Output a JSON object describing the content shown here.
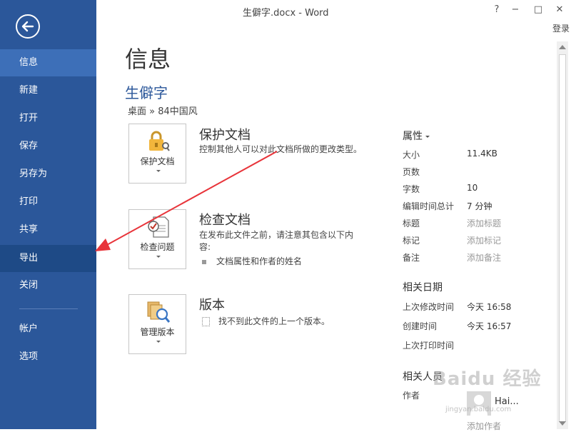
{
  "window": {
    "title": "生僻字.docx - Word",
    "help": "?",
    "minimize": "−",
    "maximize": "□",
    "close": "✕",
    "login": "登录"
  },
  "sidebar": {
    "items": [
      {
        "label": "信息",
        "state": "selected"
      },
      {
        "label": "新建"
      },
      {
        "label": "打开"
      },
      {
        "label": "保存"
      },
      {
        "label": "另存为"
      },
      {
        "label": "打印"
      },
      {
        "label": "共享"
      },
      {
        "label": "导出",
        "state": "highlight"
      },
      {
        "label": "关闭"
      },
      {
        "label": "帐户"
      },
      {
        "label": "选项"
      }
    ]
  },
  "main": {
    "title": "信息",
    "doc_name": "生僻字",
    "path": "桌面 » 84中国风",
    "protect": {
      "button": "保护文档",
      "title": "保护文档",
      "desc": "控制其他人可以对此文档所做的更改类型。"
    },
    "inspect": {
      "button": "检查问题",
      "title": "检查文档",
      "desc": "在发布此文件之前，请注意其包含以下内容:",
      "bullet": "文档属性和作者的姓名"
    },
    "versions": {
      "button": "管理版本",
      "title": "版本",
      "desc": "找不到此文件的上一个版本。"
    }
  },
  "properties": {
    "heading": "属性",
    "rows": [
      {
        "label": "大小",
        "value": "11.4KB"
      },
      {
        "label": "页数",
        "value": ""
      },
      {
        "label": "字数",
        "value": "10"
      },
      {
        "label": "编辑时间总计",
        "value": "7 分钟"
      },
      {
        "label": "标题",
        "value": "添加标题",
        "placeholder": true
      },
      {
        "label": "标记",
        "value": "添加标记",
        "placeholder": true
      },
      {
        "label": "备注",
        "value": "添加备注",
        "placeholder": true
      }
    ],
    "dates_heading": "相关日期",
    "dates": [
      {
        "label": "上次修改时间",
        "value": "今天 16:58"
      },
      {
        "label": "创建时间",
        "value": "今天 16:57"
      },
      {
        "label": "上次打印时间",
        "value": ""
      }
    ],
    "people_heading": "相关人员",
    "author_label": "作者",
    "author_name": "Hai...",
    "add_author": "添加作者"
  },
  "watermark": {
    "text": "Baidu 经验",
    "sub": "jingyan.baidu.com"
  },
  "colors": {
    "sidebar": "#2b579a",
    "selected": "#3d6fb8",
    "highlight": "#1e4a86",
    "annotation_arrow": "#e8343a"
  }
}
